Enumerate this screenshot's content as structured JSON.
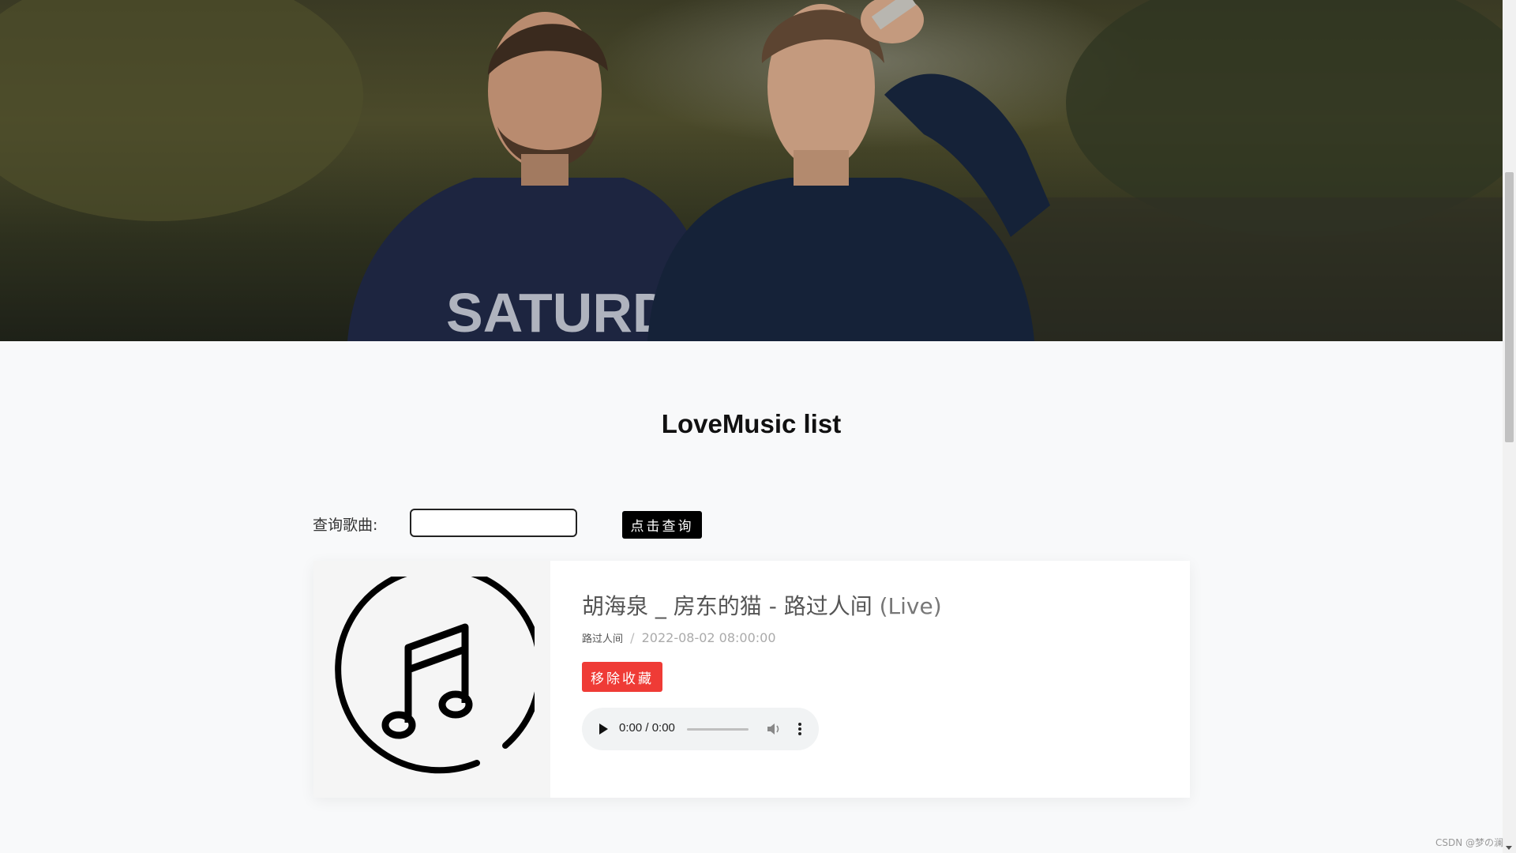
{
  "hero": {
    "image": "band-photo-banner"
  },
  "page": {
    "title": "LoveMusic list"
  },
  "search": {
    "label": "查询歌曲:",
    "input_value": "",
    "button_label": "点击查询"
  },
  "songs": [
    {
      "title": "胡海泉 _ 房东的猫 - 路过人间",
      "title_suffix": "(Live)",
      "singer": "路过人间",
      "separator": "/",
      "date": "2022-08-02 08:00:00",
      "remove_label": "移除收藏",
      "player": {
        "time": "0:00 / 0:00",
        "progress": 0
      },
      "cover_icon": "music-note-icon"
    }
  ],
  "watermark": "CSDN @梦の澜",
  "colors": {
    "remove_button": "#ef3b36",
    "search_button": "#000000",
    "page_bg": "#f8f9fa"
  }
}
